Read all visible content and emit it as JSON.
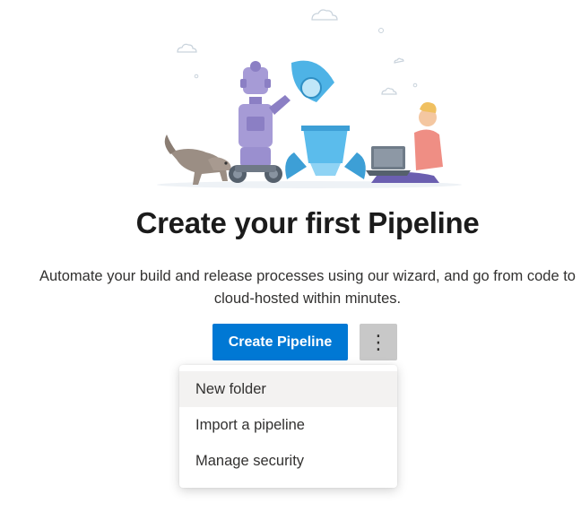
{
  "title": "Create your first Pipeline",
  "description": "Automate your build and release processes using our wizard, and go from code to cloud-hosted within minutes.",
  "create_button": "Create Pipeline",
  "more_button": "⋮",
  "menu": {
    "items": [
      {
        "label": "New folder"
      },
      {
        "label": "Import a pipeline"
      },
      {
        "label": "Manage security"
      }
    ]
  },
  "colors": {
    "primary": "#0078d4",
    "more_button_bg": "#c8c8c8",
    "hover_bg": "#f3f2f1",
    "title": "#1b1b1b"
  }
}
